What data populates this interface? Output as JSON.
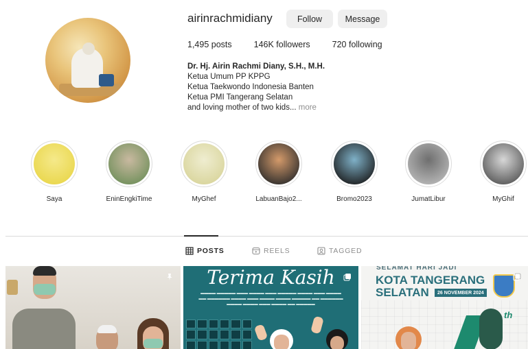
{
  "profile": {
    "username": "airinrachmidiany",
    "follow_label": "Follow",
    "message_label": "Message",
    "posts": "1,495 posts",
    "followers": "146K followers",
    "following": "720 following",
    "full_name": "Dr. Hj. Airin Rachmi Diany, S.H., M.H.",
    "bio_lines": [
      "Ketua Umum PP KPPG",
      "Ketua Taekwondo Indonesia Banten",
      "Ketua PMI Tangerang Selatan",
      "and loving mother of two kids..."
    ],
    "more_label": "more"
  },
  "highlights": [
    {
      "label": "Saya",
      "colors": [
        "#e9d64a",
        "#f5e98a"
      ]
    },
    {
      "label": "EninEngkiTime",
      "colors": [
        "#6f8f5a",
        "#c9b9a0"
      ]
    },
    {
      "label": "MyGhef",
      "colors": [
        "#d8d49a",
        "#efedd0"
      ]
    },
    {
      "label": "LabuanBajo2...",
      "colors": [
        "#2b2b2b",
        "#d49a6a"
      ]
    },
    {
      "label": "Bromo2023",
      "colors": [
        "#1a1a1a",
        "#7fb1c8"
      ]
    },
    {
      "label": "JumatLibur",
      "colors": [
        "#b9b9b9",
        "#6f6f6f"
      ]
    },
    {
      "label": "MyGhif",
      "colors": [
        "#555555",
        "#d7d7d7"
      ]
    }
  ],
  "tabs": [
    {
      "label": "POSTS",
      "icon": "grid-icon",
      "active": true
    },
    {
      "label": "REELS",
      "icon": "reels-icon",
      "active": false
    },
    {
      "label": "TAGGED",
      "icon": "tagged-icon",
      "active": false
    }
  ],
  "posts": [
    {
      "icon": "pin-icon"
    },
    {
      "title": "Terima Kasih",
      "icon": "multiple-photos-icon"
    },
    {
      "subtitle": "SELAMAT HARI JADI",
      "line1": "KOTA TANGERANG",
      "line2": "SELATAN",
      "date": "26 NOVEMBER 2024",
      "badge": "th",
      "icon": "multiple-photos-icon"
    }
  ]
}
